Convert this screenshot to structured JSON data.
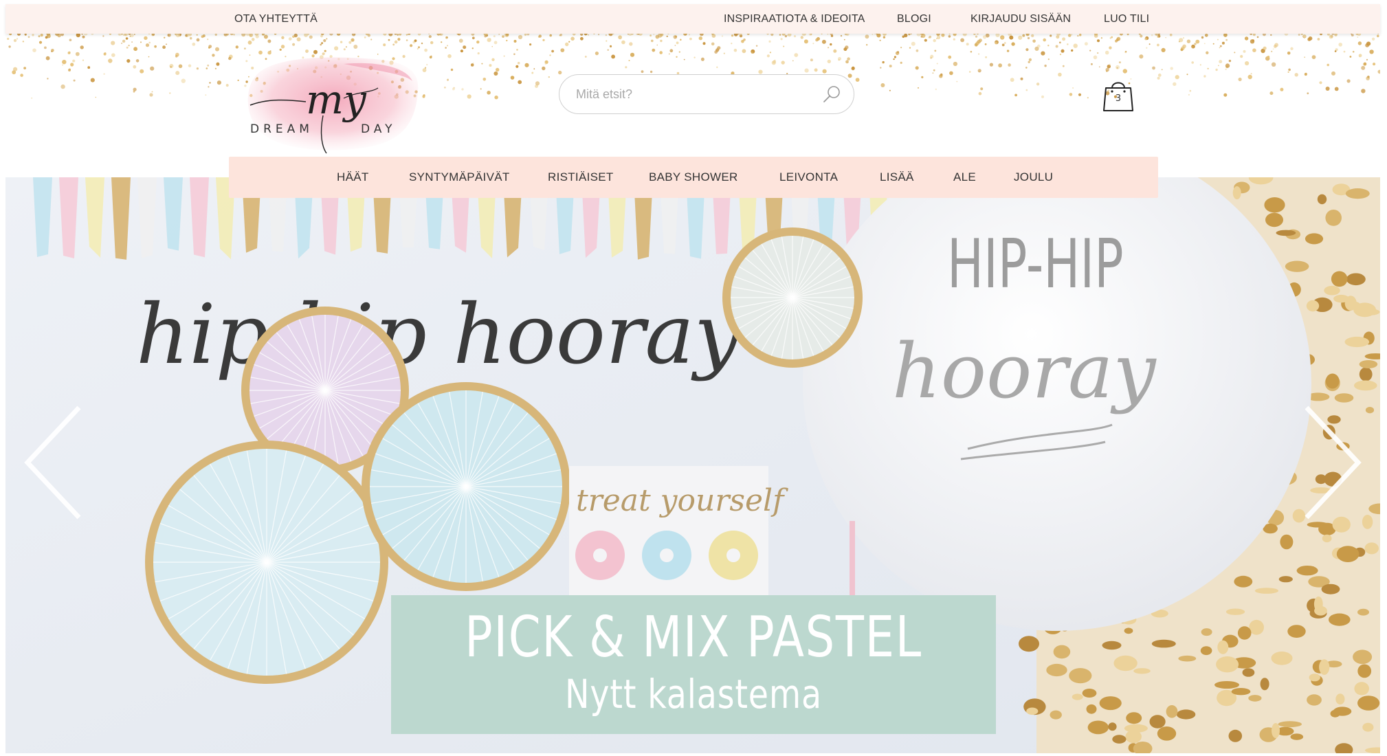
{
  "topbar": {
    "contact": "OTA YHTEYTTÄ",
    "inspiration": "INSPIRAATIOTA & IDEOITA",
    "blog": "BLOGI",
    "login": "KIRJAUDU SISÄÄN",
    "create_account": "LUO TILI"
  },
  "logo": {
    "script": "my",
    "word1": "DREAM",
    "word2": "DAY"
  },
  "search": {
    "placeholder": "Mitä etsit?"
  },
  "cart": {
    "count": "3"
  },
  "nav": {
    "items": [
      "HÄÄT",
      "SYNTYMÄPÄIVÄT",
      "RISTIÄISET",
      "BABY SHOWER",
      "LEIVONTA",
      "LISÄÄ",
      "ALE",
      "JOULU"
    ]
  },
  "hero": {
    "title": "PICK & MIX PASTEL",
    "subtitle": "Nytt kalastema",
    "image_text": {
      "garland": "hip hip hooray",
      "balloon_top": "HIP-HIP",
      "balloon_bottom": "hooray",
      "sign": "treat yourself"
    }
  },
  "colors": {
    "topbar_bg": "#fdf2ee",
    "nav_bg": "#fde4dc",
    "caption_bg": "#bcd8cf",
    "confetti_gold": "#d8ad5c"
  },
  "icons": {
    "search": "search-icon",
    "cart": "shopping-bag-icon",
    "prev": "chevron-left-icon",
    "next": "chevron-right-icon"
  }
}
